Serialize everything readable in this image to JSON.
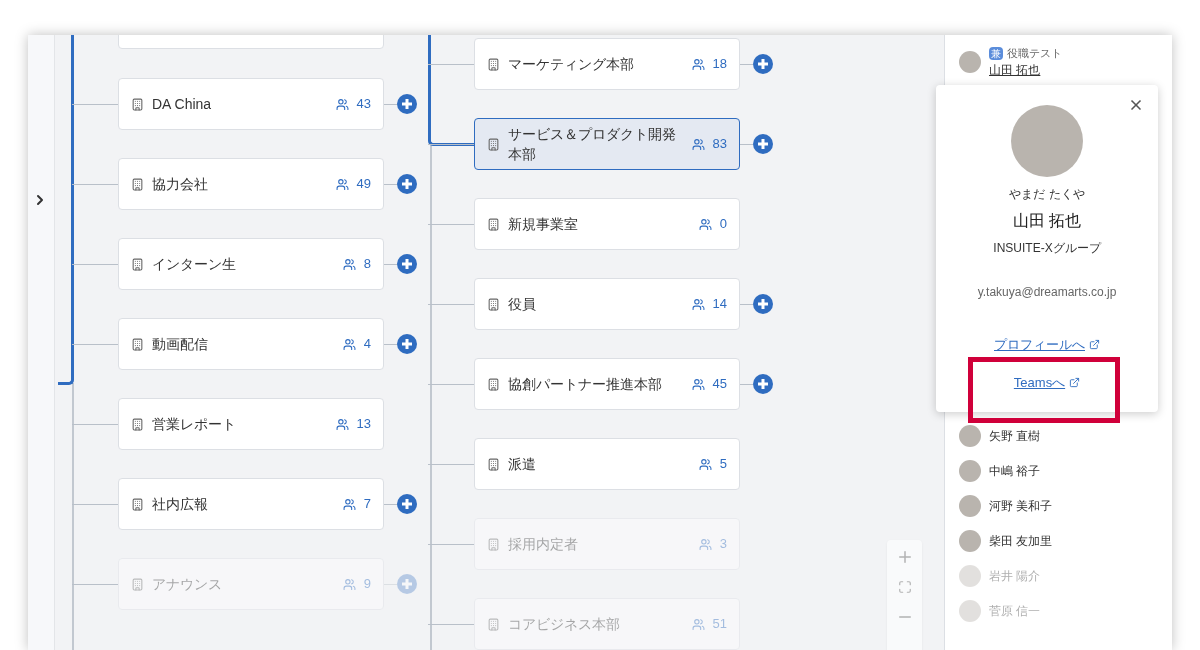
{
  "tree": {
    "column_1": [
      {
        "name": "DA China",
        "count": "43",
        "selected": false,
        "has_children": true,
        "faded": false
      },
      {
        "name": "協力会社",
        "count": "49",
        "selected": false,
        "has_children": true,
        "faded": false
      },
      {
        "name": "インターン生",
        "count": "8",
        "selected": false,
        "has_children": true,
        "faded": false
      },
      {
        "name": "動画配信",
        "count": "4",
        "selected": false,
        "has_children": true,
        "faded": false
      },
      {
        "name": "営業レポート",
        "count": "13",
        "selected": false,
        "has_children": false,
        "faded": false
      },
      {
        "name": "社内広報",
        "count": "7",
        "selected": false,
        "has_children": true,
        "faded": false
      },
      {
        "name": "アナウンス",
        "count": "9",
        "selected": false,
        "has_children": true,
        "faded": true
      }
    ],
    "column_2": [
      {
        "name": "マーケティング本部",
        "count": "18",
        "selected": false,
        "has_children": true,
        "faded": false
      },
      {
        "name": "サービス＆プロダクト開発本部",
        "count": "83",
        "selected": true,
        "has_children": true,
        "faded": false
      },
      {
        "name": "新規事業室",
        "count": "0",
        "selected": false,
        "has_children": false,
        "faded": false
      },
      {
        "name": "役員",
        "count": "14",
        "selected": false,
        "has_children": true,
        "faded": false
      },
      {
        "name": "協創パートナー推進本部",
        "count": "45",
        "selected": false,
        "has_children": true,
        "faded": false
      },
      {
        "name": "派遣",
        "count": "5",
        "selected": false,
        "has_children": false,
        "faded": false
      },
      {
        "name": "採用内定者",
        "count": "3",
        "selected": false,
        "has_children": false,
        "faded": true
      },
      {
        "name": "コアビジネス本部",
        "count": "51",
        "selected": false,
        "has_children": false,
        "faded": true
      }
    ]
  },
  "members": [
    {
      "name": "山田 拓也",
      "badge": "兼",
      "role": "役職テスト",
      "faded": false
    },
    {
      "name": "矢野 直樹",
      "faded": false
    },
    {
      "name": "中嶋 裕子",
      "faded": false
    },
    {
      "name": "河野 美和子",
      "faded": false
    },
    {
      "name": "柴田 友加里",
      "faded": false
    },
    {
      "name": "岩井 陽介",
      "faded": true
    },
    {
      "name": "菅原 信一",
      "faded": true
    }
  ],
  "profile_popup": {
    "kana": "やまだ たくや",
    "name": "山田 拓也",
    "group": "INSUITE-Xグループ",
    "email": "y.takuya@dreamarts.co.jp",
    "links": [
      "プロフィールへ",
      "Teamsへ"
    ]
  }
}
